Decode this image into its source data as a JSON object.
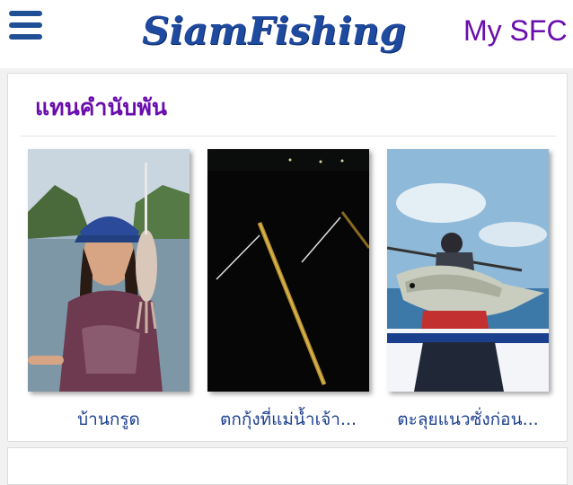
{
  "header": {
    "logo_text": "SiamFishing",
    "account_link": "My SFC",
    "menu_icon": "hamburger-menu-icon"
  },
  "section": {
    "title": "แทนคำนับพัน",
    "posts": [
      {
        "caption": "บ้านกรูด",
        "image": "woman-holding-squid-photo"
      },
      {
        "caption": "ตกกุ้งที่แม่น้ำเจ้า...",
        "image": "night-fishing-rods-photo"
      },
      {
        "caption": "ตะลุยแนวซั่งก่อน...",
        "image": "angler-holding-trevally-photo"
      }
    ]
  },
  "colors": {
    "brand_blue": "#1e4aa0",
    "accent_purple": "#6a0dad",
    "caption_blue": "#1b3f8f"
  }
}
